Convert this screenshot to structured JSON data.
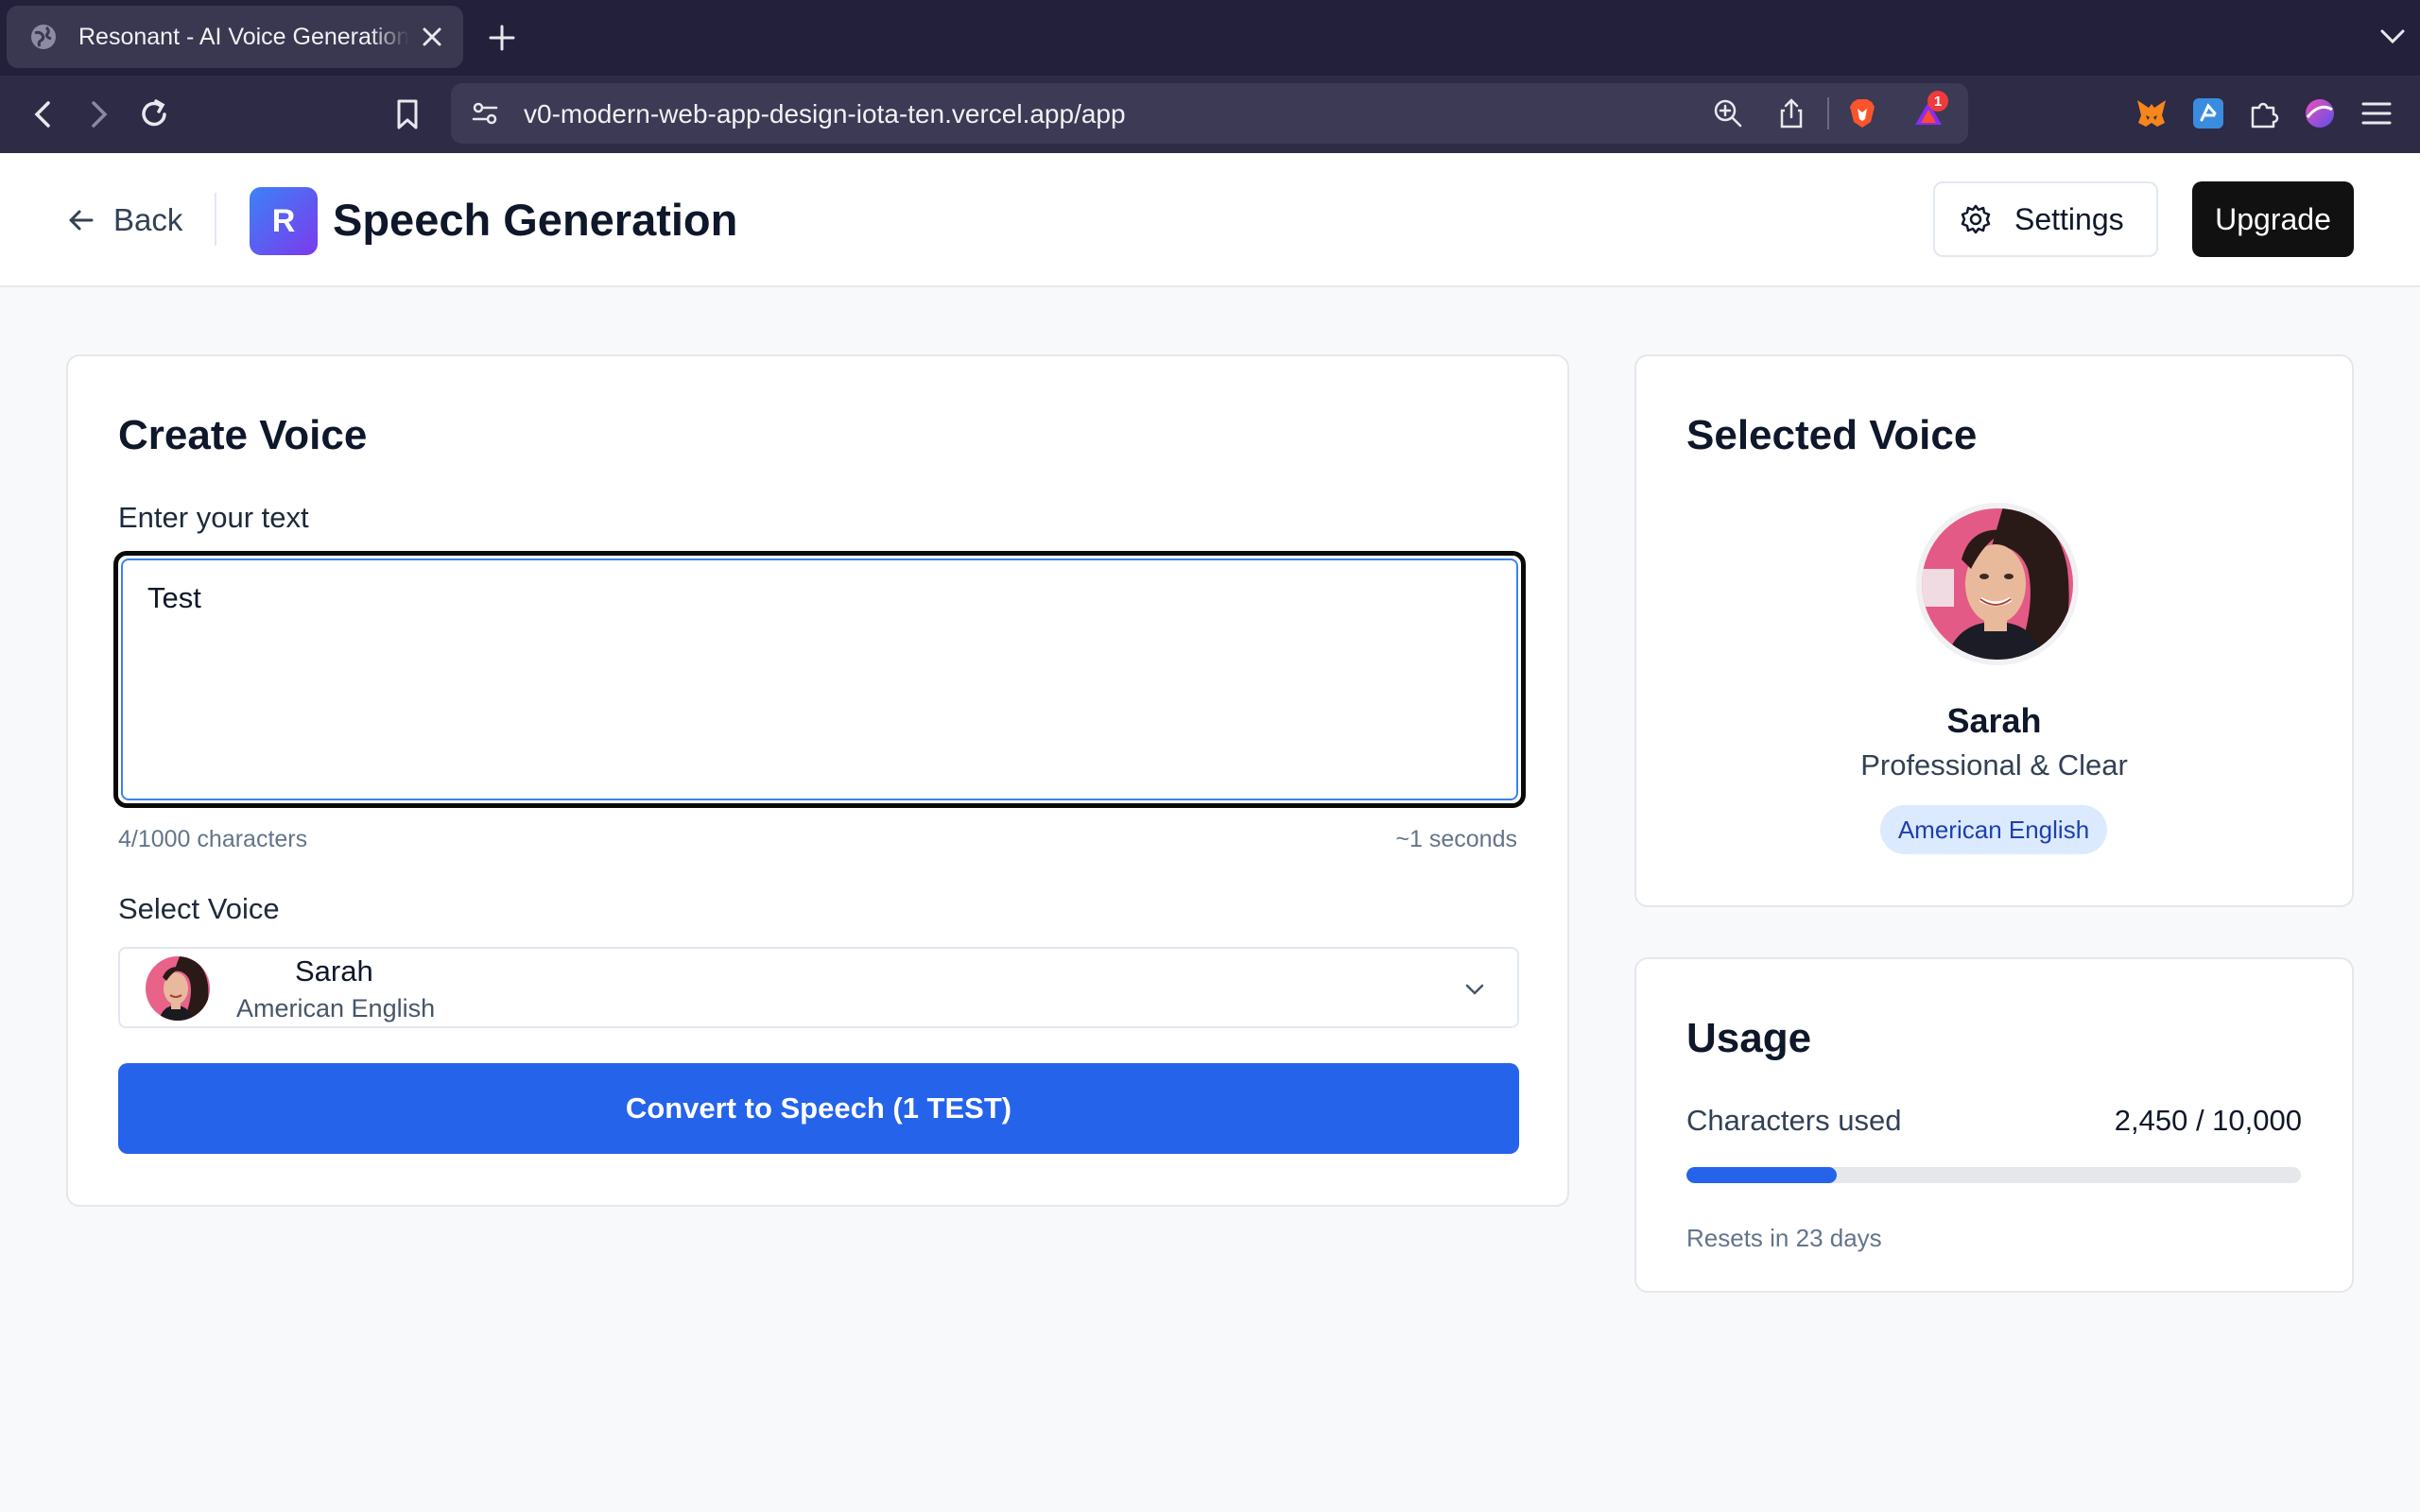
{
  "browser": {
    "tab_title": "Resonant - AI Voice Generation",
    "url": "v0-modern-web-app-design-iota-ten.vercel.app/app",
    "notification_count": "1"
  },
  "header": {
    "back_label": "Back",
    "logo_letter": "R",
    "title": "Speech Generation",
    "settings_label": "Settings",
    "upgrade_label": "Upgrade"
  },
  "create": {
    "title": "Create Voice",
    "text_label": "Enter your text",
    "text_value": "Test",
    "char_count": "4/1000 characters",
    "duration": "~1 seconds",
    "voice_label": "Select Voice",
    "selected_voice_name": "Sarah",
    "selected_voice_lang": "American English",
    "convert_label": "Convert to Speech (1 TEST)"
  },
  "selected_voice": {
    "title": "Selected Voice",
    "name": "Sarah",
    "style": "Professional & Clear",
    "language": "American English"
  },
  "usage": {
    "title": "Usage",
    "label": "Characters used",
    "value": "2,450 / 10,000",
    "used": 2450,
    "limit": 10000,
    "reset_text": "Resets in 23 days"
  },
  "colors": {
    "accent": "#2563eb",
    "badge_bg": "#dbeafe",
    "badge_text": "#1e40af",
    "browser_bg": "#22203a"
  }
}
